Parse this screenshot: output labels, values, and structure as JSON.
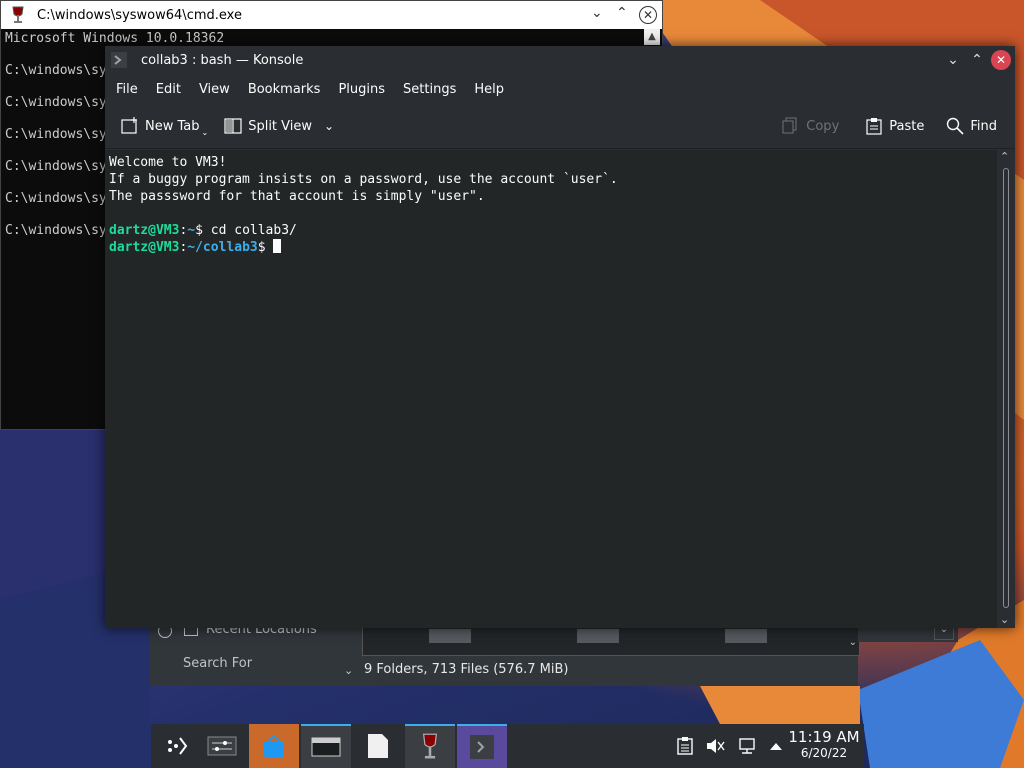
{
  "cmd": {
    "title": "C:\\windows\\syswow64\\cmd.exe",
    "lines": [
      "Microsoft Windows 10.0.18362",
      "",
      "C:\\windows\\sy",
      "",
      "C:\\windows\\sy",
      "",
      "C:\\windows\\sy",
      "",
      "C:\\windows\\sy",
      "",
      "C:\\windows\\sy",
      "",
      "C:\\windows\\sy"
    ]
  },
  "konsole": {
    "title": "collab3 : bash — Konsole",
    "menu": [
      "File",
      "Edit",
      "View",
      "Bookmarks",
      "Plugins",
      "Settings",
      "Help"
    ],
    "toolbar": {
      "new_tab": "New Tab",
      "split_view": "Split View",
      "copy": "Copy",
      "paste": "Paste",
      "find": "Find"
    },
    "terminal": {
      "line1": "Welcome to VM3!",
      "line2": "If a buggy program insists on a password, use the account `user`.",
      "line3": "The passsword for that account is simply \"user\".",
      "prompt_user": "dartz@VM3",
      "prompt1_path": "~",
      "cmd1": "cd collab3/",
      "prompt2_path": "~/collab3"
    }
  },
  "dolphin": {
    "recent_locations": "Recent Locations",
    "search_for": "Search For",
    "status": "9 Folders, 713 Files (576.7 MiB)"
  },
  "taskbar": {
    "time": "11:19 AM",
    "date": "6/20/22"
  },
  "colors": {
    "accent": "#3daee9",
    "prompt_green": "#1cdc9a",
    "close_red": "#da4453"
  }
}
